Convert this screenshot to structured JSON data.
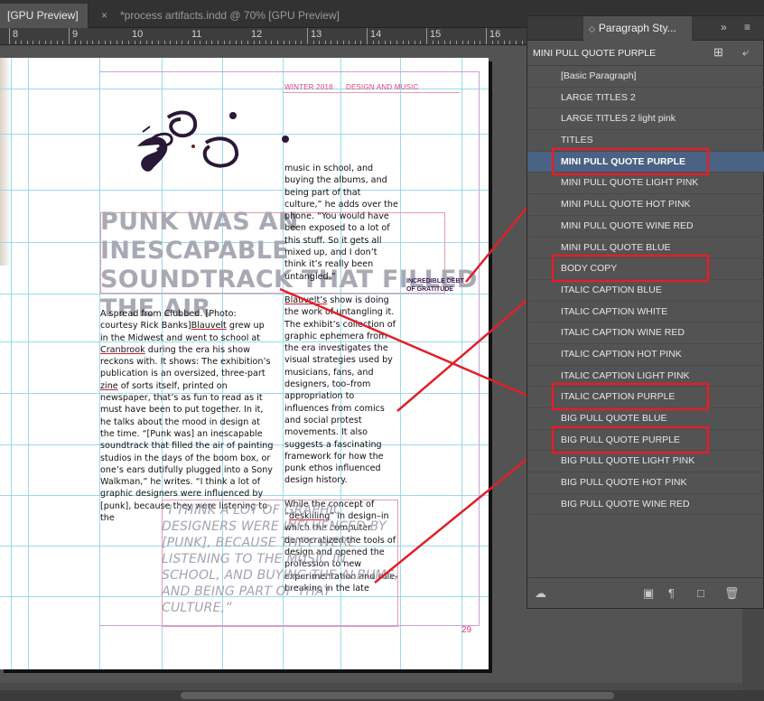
{
  "tabs": [
    {
      "label": "[GPU Preview]"
    },
    {
      "label": "*process artifacts.indd @ 70% [GPU Preview]",
      "close": "×"
    }
  ],
  "ruler": {
    "numbers": [
      "8",
      "9",
      "10",
      "11",
      "12",
      "13",
      "14",
      "15",
      "16"
    ]
  },
  "page": {
    "header_left": "WINTER 2018",
    "header_right": "DESIGN AND MUSIC",
    "headline": "PUNK WAS AN INESCAPABLE SOUNDTRACK THAT FILLED THE AIR",
    "body_left": [
      {
        "text": "A spread from Clubbed. [Photo: courtesy Rick Banks]"
      },
      {
        "u": "Blauvelt"
      },
      {
        "text": " grew up in the Midwest and went to school at "
      },
      {
        "u": "Cranbrook"
      },
      {
        "text": " during the era his show reckons with. It shows: The exhibition’s publication is an oversized, three-part "
      },
      {
        "u": "zine"
      },
      {
        "text": " of sorts itself, printed on newspaper, that’s as fun to read as it must have been to put together. In it, he talks about the mood in design at the time. “[Punk was] an inescapable soundtrack that filled the air of painting studios in the days of the boom box, or one’s ears dutifully plugged into a Sony Walkman,” he writes. “I think a lot of graphic designers were influenced by [punk], because they were listening to the"
      }
    ],
    "body_right_p1": "music in school, and buying the albums, and being part of that culture,” he adds over the phone. “You would have been exposed to a lot of this stuff. So it gets all mixed up, and I don’t think it’s really been untangled.”",
    "body_right_p2_u": "Blauvelt’s",
    "body_right_p2": " show is doing the work of untangling it. The exhibit’s collection of graphic ephemera from the era investigates the visual strategies used by musicians, fans, and designers, too–from appropriation to influences from comics and social protest movements. It also suggests a fascinating framework for how the punk ethos influenced design history.",
    "body_right_p3a": "While the concept of “",
    "body_right_p3_u": "deskilling",
    "body_right_p3b": "” in design–in which the computer democratized the tools of design and opened the profession to new experimentation and rule-breaking in the late",
    "mini_pull": "INCREDIBLE DEBT OF GRATITUDE",
    "big_pull": "“I THINK A LOT OF GRAPHIC DESIGNERS WERE INFLUENCED BY [PUNK], BECAUSE THEY WERE LISTENING TO THE MUSIC IN SCHOOL, AND BUYING THE ALBUMS, AND BEING PART OF THAT CULTURE,”",
    "page_number": "29"
  },
  "panel": {
    "title": "Paragraph Sty...",
    "current_style": "MINI PULL  QUOTE PURPLE",
    "styles": [
      "[Basic Paragraph]",
      "LARGE TITLES 2",
      "LARGE TITLES 2 light pink",
      "TITLES",
      "MINI PULL  QUOTE PURPLE",
      "MINI PULL  QUOTE LIGHT PINK",
      "MINI PULL  QUOTE HOT PINK",
      "MINI PULL  QUOTE WINE RED",
      "MINI PULL QUOTE BLUE",
      "BODY COPY",
      "ITALIC CAPTION BLUE",
      "ITALIC CAPTION WHITE",
      "ITALIC CAPTION WINE RED",
      "ITALIC CAPTION HOT PINK",
      "ITALIC CAPTION LIGHT PINK",
      "ITALIC CAPTION PURPLE",
      "BIG PULL QUOTE BLUE",
      "BIG PULL QUOTE PURPLE",
      "BIG PULL QUOTE LIGHT PINK",
      "BIG PULL QUOTE HOT PINK",
      "BIG PULL QUOTE WINE RED"
    ],
    "selected_index": 4
  },
  "colors": {
    "annotation_red": "#e0202a",
    "accent_pink": "#e0407a",
    "selection": "#4a6283"
  }
}
